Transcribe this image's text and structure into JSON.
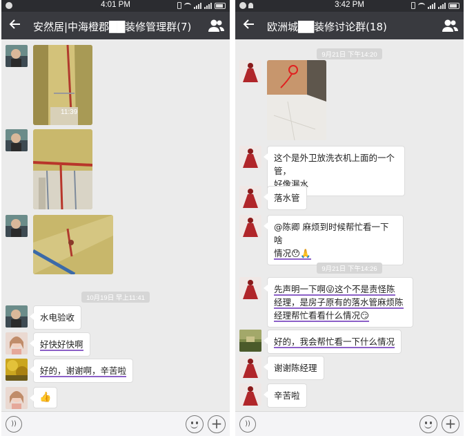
{
  "left": {
    "status_time": "4:01 PM",
    "title": "安然居|中海橙郡██装修管理群(7)",
    "timestamp": "10月19日 早上11:41",
    "photo_time": "11:39",
    "messages": [
      {
        "text": "水电验收"
      },
      {
        "text": "好快好快啊"
      },
      {
        "text": "好的，谢谢啊，辛苦啦"
      },
      {
        "text": "👍"
      }
    ]
  },
  "right": {
    "status_time": "3:42 PM",
    "title": "欧洲城██装修讨论群(18)",
    "timestamps": [
      "9月21日 下午14:20",
      "9月21日 下午14:26"
    ],
    "messages": [
      {
        "line1": "这个是外卫放洗衣机上面的一个管，",
        "line2": "好像漏水"
      },
      {
        "text": "落水管"
      },
      {
        "line1": "@陈卿  麻烦到时候帮忙看一下啥",
        "line2": "情况😯🙏"
      },
      {
        "line1": "先声明一下啊😜这个不是责怪陈",
        "line2": "经理，是房子原有的落水管麻烦陈",
        "line3": "经理帮忙看看什么情况😏"
      },
      {
        "text": "好的，我会帮忙看一下什么情况"
      },
      {
        "text": "谢谢陈经理"
      },
      {
        "text": "辛苦啦"
      }
    ]
  },
  "icons": {
    "voice": "))"
  },
  "colors": {
    "titlebar": "#393a3f",
    "statusbar": "#2b2c30",
    "chat_bg": "#ebebeb",
    "underline": "#8b5fc7"
  }
}
